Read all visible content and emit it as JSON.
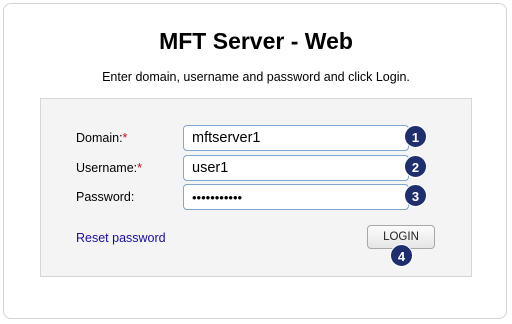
{
  "header": {
    "title": "MFT Server - Web",
    "subtitle": "Enter domain, username and password and click Login."
  },
  "form": {
    "domain": {
      "label": "Domain:",
      "required_mark": "*",
      "value": "mftserver1"
    },
    "username": {
      "label": "Username:",
      "required_mark": "*",
      "value": "user1"
    },
    "password": {
      "label": "Password:",
      "value": "•••••••••••"
    },
    "reset_link": "Reset password",
    "login_button": "LOGIN"
  },
  "badges": [
    "1",
    "2",
    "3",
    "4"
  ],
  "colors": {
    "badge": "#1f2f6e",
    "link": "#1a0dab",
    "required": "#d0021b",
    "field_border": "#7fa7cf",
    "panel_bg": "#f4f4f4"
  }
}
